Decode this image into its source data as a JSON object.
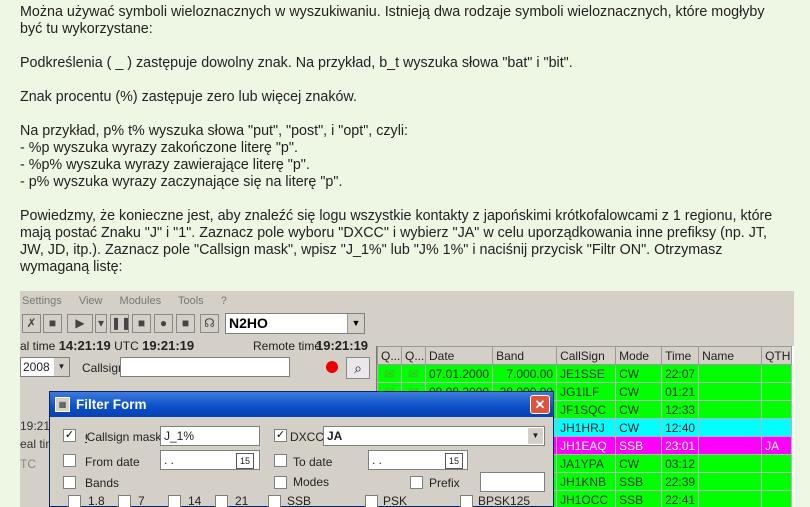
{
  "doc": {
    "p1": "Można używać symboli wieloznacznych w wyszukiwaniu. Istnieją dwa rodzaje symboli wieloznacznych, które mogłyby",
    "p1b": "być tu wykorzystane:",
    "p2": "Podkreślenia ( _ ) zastępuje dowolny znak. Na przykład, b_t wyszuka słowa \"bat\" i \"bit\".",
    "p3": "Znak procentu (%) zastępuje zero lub więcej znaków.",
    "p4": "Na przykład, p% t% wyszuka słowa \"put\", \"post\", i \"opt\", czyli:",
    "p5": "- %p wyszuka wyrazy zakończone literę \"p\".",
    "p6": "- %p% wyszuka wyrazy zawierające literę \"p\".",
    "p7": "- p% wyszuka wyrazy zaczynające się na literę \"p\".",
    "p8a": "Powiedzmy, że konieczne jest, aby znaleźć się logu wszystkie kontakty z japońskimi krótkofalowcami z 1 regionu, które",
    "p8b": "mają postać Znaku \"J\" i \"1\". Zaznacz pole wyboru \"DXCC\" i wybierz \"JA\" w celu uporządkowania inne prefiksy (np. JT,",
    "p8c": "JW, JD, itp.). Zaznacz pole \"Callsign mask\", wpisz \"J_1%\" lub \"J% 1%\" i naciśnij przycisk \"Filtr ON\". Otrzymasz",
    "p8d": "wymaganą listę:"
  },
  "app": {
    "menu": [
      "Settings",
      "View",
      "Modules",
      "Tools",
      "?"
    ],
    "callsign_select": "N2HO",
    "local_time_label": "al time",
    "local_time": "14:21:19",
    "utc_label": "UTC",
    "utc_time": "19:21:19",
    "remote_time_label": "Remote time",
    "remote_time": "19:21:19",
    "year_select": "2008",
    "callsign_label": "Callsign",
    "left_stub_1": "19:21",
    "left_stub_2": "eal tim",
    "left_stub_3": "TC",
    "grid": {
      "headers": [
        "Q...",
        "Q...",
        "Date",
        "Band",
        "CallSign",
        "Mode",
        "Time",
        "Name",
        "QTH"
      ],
      "rows": [
        {
          "date": "07.01.2000",
          "band": "7.000.00",
          "call": "JE1SSE",
          "mode": "CW",
          "time": "22:07",
          "qth": "",
          "color": "green"
        },
        {
          "date": "08.08.2000",
          "band": "28.000.00",
          "call": "JG1ILF",
          "mode": "CW",
          "time": "01:21",
          "qth": "",
          "color": "green"
        },
        {
          "date": "",
          "band": "",
          "call": "JF1SQC",
          "mode": "CW",
          "time": "12:33",
          "qth": "",
          "color": "green"
        },
        {
          "date": "",
          "band": "",
          "call": "JH1HRJ",
          "mode": "CW",
          "time": "12:40",
          "qth": "",
          "color": "cyan"
        },
        {
          "date": "",
          "band": "",
          "call": "JH1EAQ",
          "mode": "SSB",
          "time": "23:01",
          "qth": "JA",
          "color": "magenta"
        },
        {
          "date": "",
          "band": "",
          "call": "JA1YPA",
          "mode": "CW",
          "time": "03:12",
          "qth": "",
          "color": "green"
        },
        {
          "date": "",
          "band": "",
          "call": "JH1KNB",
          "mode": "SSB",
          "time": "22:39",
          "qth": "",
          "color": "green"
        },
        {
          "date": "",
          "band": "",
          "call": "JH1OCC",
          "mode": "SSB",
          "time": "22:41",
          "qth": "",
          "color": "green"
        }
      ]
    },
    "dialog": {
      "title": "Filter Form",
      "callsign_mask_label": "Callsign mask",
      "callsign_mask_value": "J_1%",
      "dxcc_label": "DXCC",
      "dxcc_value": "JA",
      "from_date_label": "From date",
      "from_date_value": " .  .",
      "to_date_label": "To date",
      "to_date_value": " .  .",
      "bands_label": "Bands",
      "modes_label": "Modes",
      "prefix_label": "Prefix",
      "band_options": [
        "1.8",
        "7",
        "14",
        "21"
      ],
      "mode_options": [
        "SSB",
        "PSK",
        "BPSK125"
      ]
    }
  },
  "colors": {
    "row_green": "#00ff00",
    "row_cyan": "#00ffff",
    "row_magenta": "#ff00ff",
    "dialog_title": "#0a4fc9"
  }
}
